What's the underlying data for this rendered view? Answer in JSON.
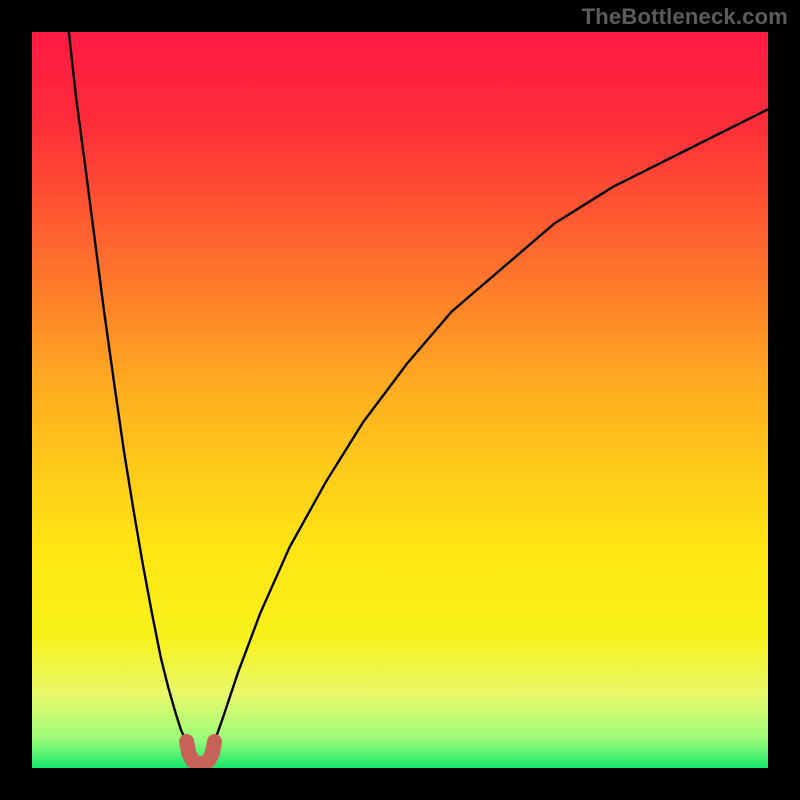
{
  "attribution": "TheBottleneck.com",
  "chart_data": {
    "type": "line",
    "title": "",
    "xlabel": "",
    "ylabel": "",
    "xlim": [
      0,
      1
    ],
    "ylim": [
      0,
      1
    ],
    "gradient_stops": [
      {
        "offset": 0.0,
        "color": "#ff1a44"
      },
      {
        "offset": 0.12,
        "color": "#ff2b3a"
      },
      {
        "offset": 0.3,
        "color": "#ff6a2e"
      },
      {
        "offset": 0.5,
        "color": "#ffb21f"
      },
      {
        "offset": 0.7,
        "color": "#ffe514"
      },
      {
        "offset": 0.82,
        "color": "#f8f21a"
      },
      {
        "offset": 0.9,
        "color": "#e8f86a"
      },
      {
        "offset": 0.96,
        "color": "#9dfc7a"
      },
      {
        "offset": 1.0,
        "color": "#17e86b"
      }
    ],
    "series": [
      {
        "name": "left-curve",
        "stroke": "#000000",
        "stroke_width": 2.4,
        "x": [
          0.05,
          0.06,
          0.072,
          0.085,
          0.098,
          0.112,
          0.125,
          0.138,
          0.15,
          0.163,
          0.175,
          0.185,
          0.195,
          0.203,
          0.21
        ],
        "y": [
          1.0,
          0.91,
          0.82,
          0.72,
          0.62,
          0.52,
          0.43,
          0.35,
          0.28,
          0.21,
          0.15,
          0.11,
          0.075,
          0.05,
          0.036
        ]
      },
      {
        "name": "right-curve",
        "stroke": "#000000",
        "stroke_width": 2.4,
        "x": [
          0.248,
          0.26,
          0.28,
          0.31,
          0.35,
          0.4,
          0.45,
          0.51,
          0.57,
          0.64,
          0.71,
          0.79,
          0.87,
          0.95,
          1.0
        ],
        "y": [
          0.036,
          0.07,
          0.13,
          0.21,
          0.3,
          0.39,
          0.47,
          0.55,
          0.62,
          0.68,
          0.74,
          0.79,
          0.83,
          0.87,
          0.895
        ]
      },
      {
        "name": "valley-marker",
        "stroke": "#c76258",
        "stroke_width": 15,
        "linecap": "round",
        "x": [
          0.21,
          0.213,
          0.218,
          0.225,
          0.232,
          0.24,
          0.245,
          0.248
        ],
        "y": [
          0.036,
          0.02,
          0.01,
          0.006,
          0.006,
          0.01,
          0.02,
          0.036
        ]
      }
    ]
  }
}
